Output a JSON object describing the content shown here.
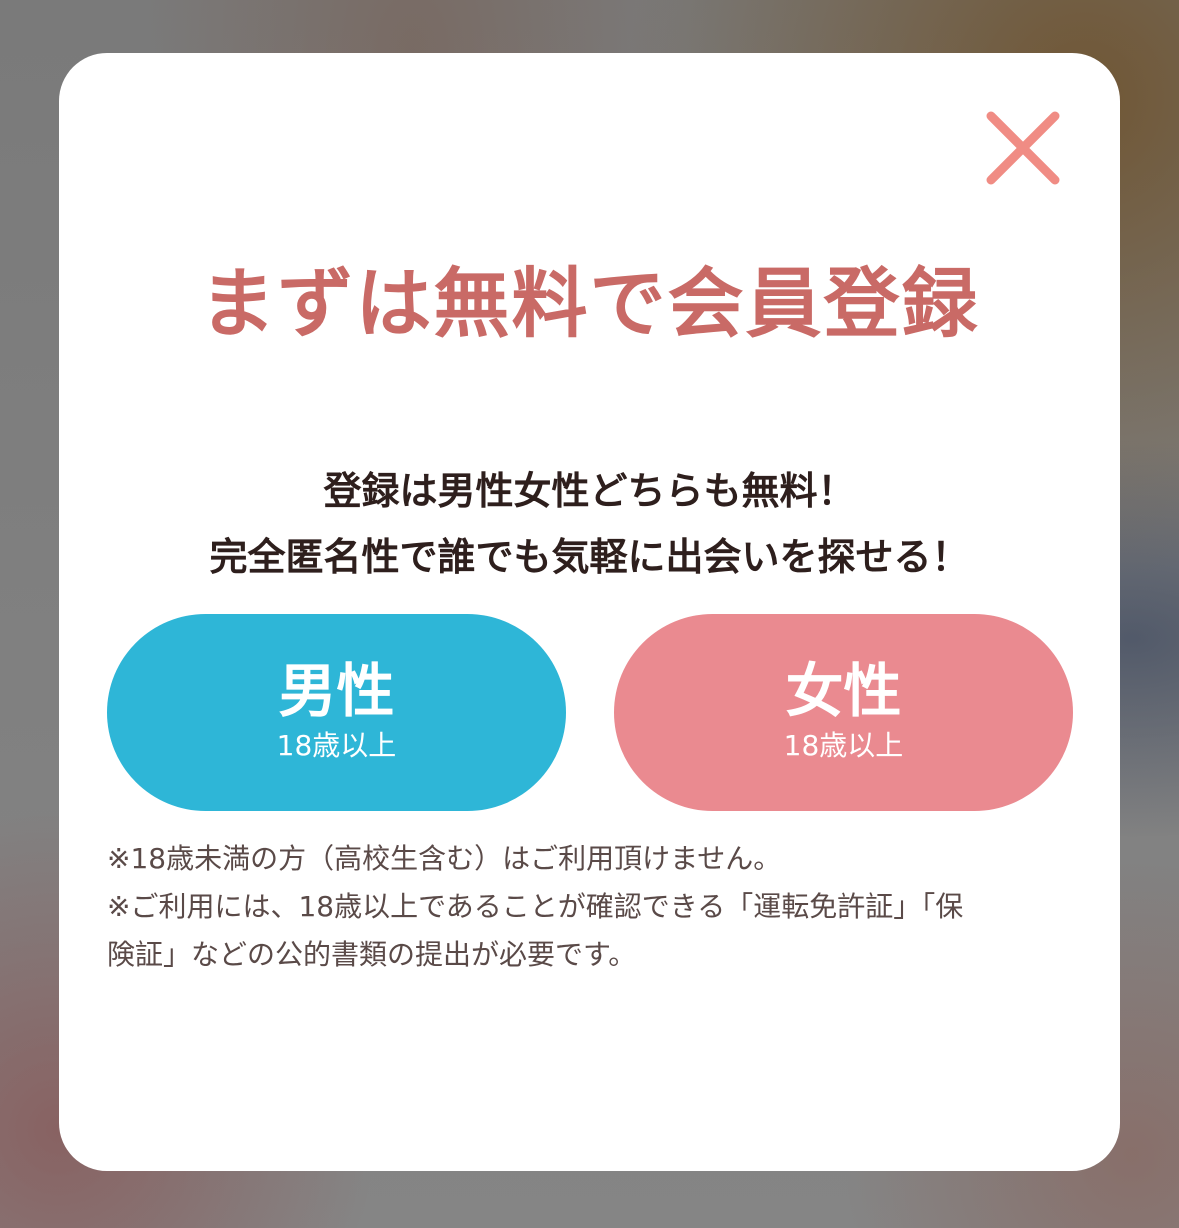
{
  "modal": {
    "title": "まずは無料で会員登録",
    "subtitle_lines": [
      "登録は男性女性どちらも無料！",
      "完全匿名性で誰でも気軽に出会いを探せる！"
    ],
    "buttons": [
      {
        "label": "男性",
        "age": "18歳以上",
        "color": "#2eb6d7"
      },
      {
        "label": "女性",
        "age": "18歳以上",
        "color": "#ea8a90"
      }
    ],
    "notes": [
      "※18歳未満の方（高校生含む）はご利用頂けません。",
      "※ご利用には、18歳以上であることが確認できる「運転免許証」「保",
      "険証」などの公的書類の提出が必要です。"
    ],
    "close_icon": "close-icon",
    "colors": {
      "title": "#c96a66",
      "close": "#f08c84",
      "male": "#2eb6d7",
      "female": "#ea8a90"
    }
  }
}
